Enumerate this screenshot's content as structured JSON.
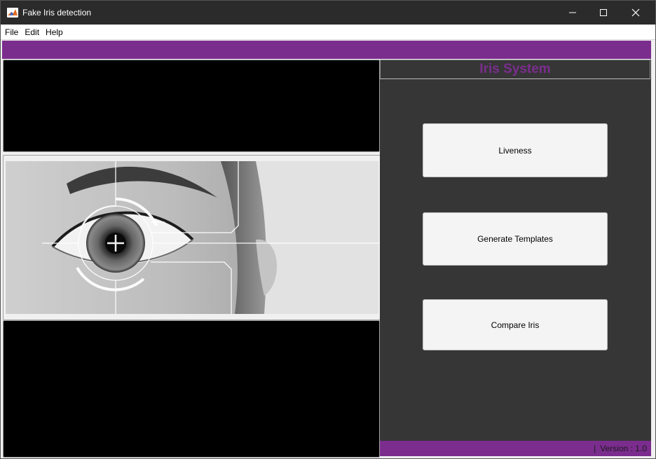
{
  "window": {
    "title": "Fake Iris detection"
  },
  "menu": {
    "items": [
      "File",
      "Edit",
      "Help"
    ]
  },
  "right_panel": {
    "title": "Iris System",
    "buttons": [
      "Liveness",
      "Generate Templates",
      "Compare Iris"
    ]
  },
  "status": {
    "separator": "|",
    "version": "Version : 1.0"
  },
  "colors": {
    "accent": "#7b2d8e",
    "panel_bg": "#363636",
    "titlebar": "#2b2b2b"
  },
  "icons": [
    "matlab-logo-icon",
    "minimize-icon",
    "maximize-icon",
    "close-icon"
  ]
}
